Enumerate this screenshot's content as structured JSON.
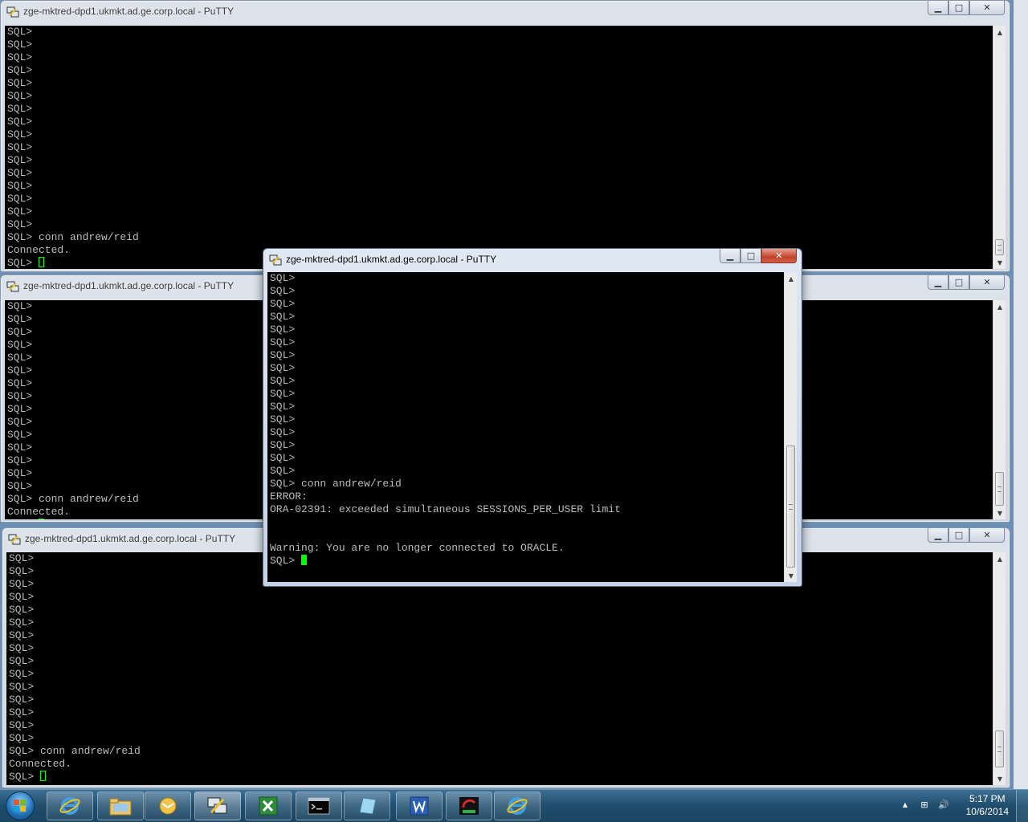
{
  "windows": {
    "top": {
      "title": "zge-mktred-dpd1.ukmkt.ad.ge.corp.local - PuTTY",
      "lines": [
        "SQL>",
        "SQL>",
        "SQL>",
        "SQL>",
        "SQL>",
        "SQL>",
        "SQL>",
        "SQL>",
        "SQL>",
        "SQL>",
        "SQL>",
        "SQL>",
        "SQL>",
        "SQL>",
        "SQL>",
        "SQL>",
        "SQL> conn andrew/reid",
        "Connected.",
        "SQL> "
      ]
    },
    "middle": {
      "title": "zge-mktred-dpd1.ukmkt.ad.ge.corp.local - PuTTY",
      "lines": [
        "SQL>",
        "SQL>",
        "SQL>",
        "SQL>",
        "SQL>",
        "SQL>",
        "SQL>",
        "SQL>",
        "SQL>",
        "SQL>",
        "SQL>",
        "SQL>",
        "SQL>",
        "SQL>",
        "SQL>",
        "SQL> conn andrew/reid",
        "Connected.",
        "SQL> "
      ]
    },
    "bottom": {
      "title": "zge-mktred-dpd1.ukmkt.ad.ge.corp.local - PuTTY",
      "lines": [
        "SQL>",
        "SQL>",
        "SQL>",
        "SQL>",
        "SQL>",
        "SQL>",
        "SQL>",
        "SQL>",
        "SQL>",
        "SQL>",
        "SQL>",
        "SQL>",
        "SQL>",
        "SQL>",
        "SQL>",
        "SQL> conn andrew/reid",
        "Connected.",
        "SQL> "
      ]
    },
    "focused": {
      "title": "zge-mktred-dpd1.ukmkt.ad.ge.corp.local - PuTTY",
      "lines": [
        "SQL>",
        "SQL>",
        "SQL>",
        "SQL>",
        "SQL>",
        "SQL>",
        "SQL>",
        "SQL>",
        "SQL>",
        "SQL>",
        "SQL>",
        "SQL>",
        "SQL>",
        "SQL>",
        "SQL>",
        "SQL>",
        "SQL> conn andrew/reid",
        "ERROR:",
        "ORA-02391: exceeded simultaneous SESSIONS_PER_USER limit",
        "",
        "",
        "Warning: You are no longer connected to ORACLE.",
        "SQL> "
      ]
    }
  },
  "window_controls": {
    "minimize": "▁",
    "maximize": "□",
    "close": "✕"
  },
  "scroll_arrows": {
    "up": "▲",
    "down": "▼"
  },
  "taskbar": {
    "apps": [
      {
        "name": "internet-explorer-icon"
      },
      {
        "name": "windows-explorer-icon"
      },
      {
        "name": "outlook-icon"
      },
      {
        "name": "putty-icon"
      },
      {
        "name": "excel-icon"
      },
      {
        "name": "command-prompt-icon"
      },
      {
        "name": "notepad-icon"
      },
      {
        "name": "word-icon"
      },
      {
        "name": "oracle-tool-icon"
      },
      {
        "name": "internet-explorer-icon-2"
      }
    ],
    "clock_time": "5:17 PM",
    "clock_date": "10/6/2014",
    "tray": {
      "show_hidden": "▲",
      "network": "⊞",
      "volume": "🔊"
    }
  },
  "colors": {
    "terminal_bg": "#000000",
    "terminal_fg": "#bbbbbb",
    "cursor": "#00ff00",
    "taskbar": "#1f4d6d"
  }
}
